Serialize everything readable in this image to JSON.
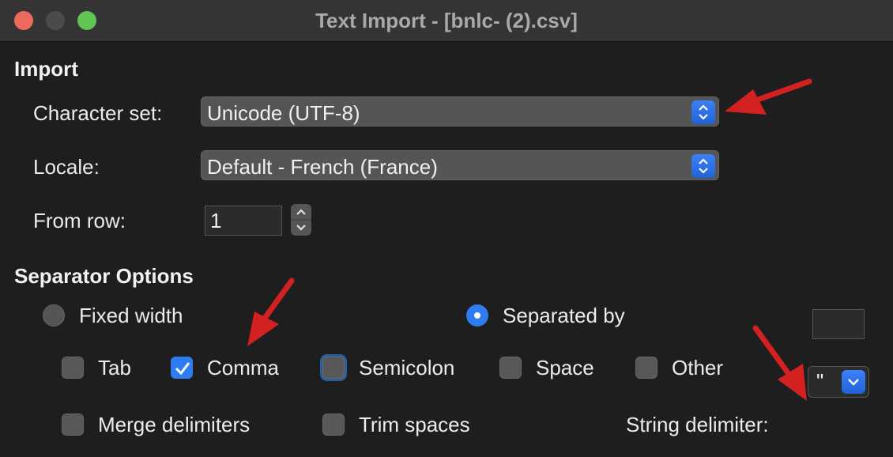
{
  "window": {
    "title": "Text Import - [bnlc- (2).csv]"
  },
  "import": {
    "section_title": "Import",
    "charset_label": "Character set:",
    "charset_value": "Unicode (UTF-8)",
    "locale_label": "Locale:",
    "locale_value": "Default - French (France)",
    "from_row_label": "From row:",
    "from_row_value": "1"
  },
  "separator": {
    "section_title": "Separator Options",
    "fixed_width_label": "Fixed width",
    "fixed_width_selected": false,
    "separated_by_label": "Separated by",
    "separated_by_selected": true,
    "options": [
      {
        "label": "Tab",
        "checked": false
      },
      {
        "label": "Comma",
        "checked": true
      },
      {
        "label": "Semicolon",
        "checked": false
      },
      {
        "label": "Space",
        "checked": false
      },
      {
        "label": "Other",
        "checked": false
      }
    ],
    "merge_label": "Merge delimiters",
    "merge_checked": false,
    "trim_label": "Trim spaces",
    "trim_checked": false,
    "string_delim_label": "String delimiter:",
    "string_delim_value": "\""
  },
  "colors": {
    "accent": "#2f7bf0",
    "annotation_arrow": "#d32020"
  }
}
